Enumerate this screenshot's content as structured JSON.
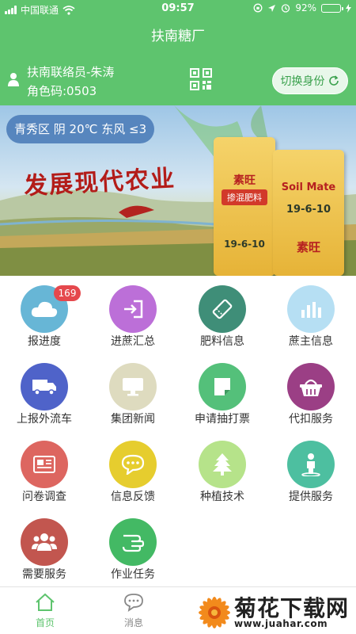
{
  "status_bar": {
    "carrier": "中国联通",
    "time": "09:57",
    "battery_percent": "92%",
    "battery_level": 0.92
  },
  "nav": {
    "title": "扶南糖厂"
  },
  "user": {
    "name": "扶南联络员-朱涛",
    "role_code": "角色码:0503",
    "switch_label": "切换身份"
  },
  "banner": {
    "weather": "青秀区 阴 20℃ 东风 ≤3",
    "title": "发展现代农业",
    "bag_left": {
      "brand": "素旺",
      "name": "掺混肥料",
      "formula": "19-6-10"
    },
    "bag_right": {
      "brand": "Soil Mate",
      "brand_cn": "素旺",
      "formula": "19-6-10"
    }
  },
  "menu": [
    {
      "label": "报进度",
      "icon": "cloud-icon",
      "color": "#67b6d6",
      "badge": "169"
    },
    {
      "label": "进蔗汇总",
      "icon": "sign-in-icon",
      "color": "#bc6fd8"
    },
    {
      "label": "肥料信息",
      "icon": "ticket-icon",
      "color": "#3f8e78"
    },
    {
      "label": "蔗主信息",
      "icon": "bar-chart-icon",
      "color": "#b6dff3"
    },
    {
      "label": "上报外流车",
      "icon": "truck-icon",
      "color": "#4f63c9"
    },
    {
      "label": "集团新闻",
      "icon": "monitor-icon",
      "color": "#dedbbf"
    },
    {
      "label": "申请抽打票",
      "icon": "note-icon",
      "color": "#54c07a"
    },
    {
      "label": "代扣服务",
      "icon": "basket-icon",
      "color": "#9b3f85"
    },
    {
      "label": "问卷调查",
      "icon": "newspaper-icon",
      "color": "#dd6660"
    },
    {
      "label": "信息反馈",
      "icon": "chat-icon",
      "color": "#e6cd2e"
    },
    {
      "label": "种植技术",
      "icon": "tree-icon",
      "color": "#b6e38a"
    },
    {
      "label": "提供服务",
      "icon": "person-icon",
      "color": "#4dbfa0"
    },
    {
      "label": "需要服务",
      "icon": "group-icon",
      "color": "#c2564f"
    },
    {
      "label": "作业任务",
      "icon": "hand-icon",
      "color": "#43b964"
    }
  ],
  "tabs": [
    {
      "label": "首页",
      "icon": "home-icon",
      "active": true
    },
    {
      "label": "消息",
      "icon": "message-icon",
      "active": false
    }
  ],
  "watermark": {
    "title": "菊花下载网",
    "url": "www.juahar.com"
  }
}
